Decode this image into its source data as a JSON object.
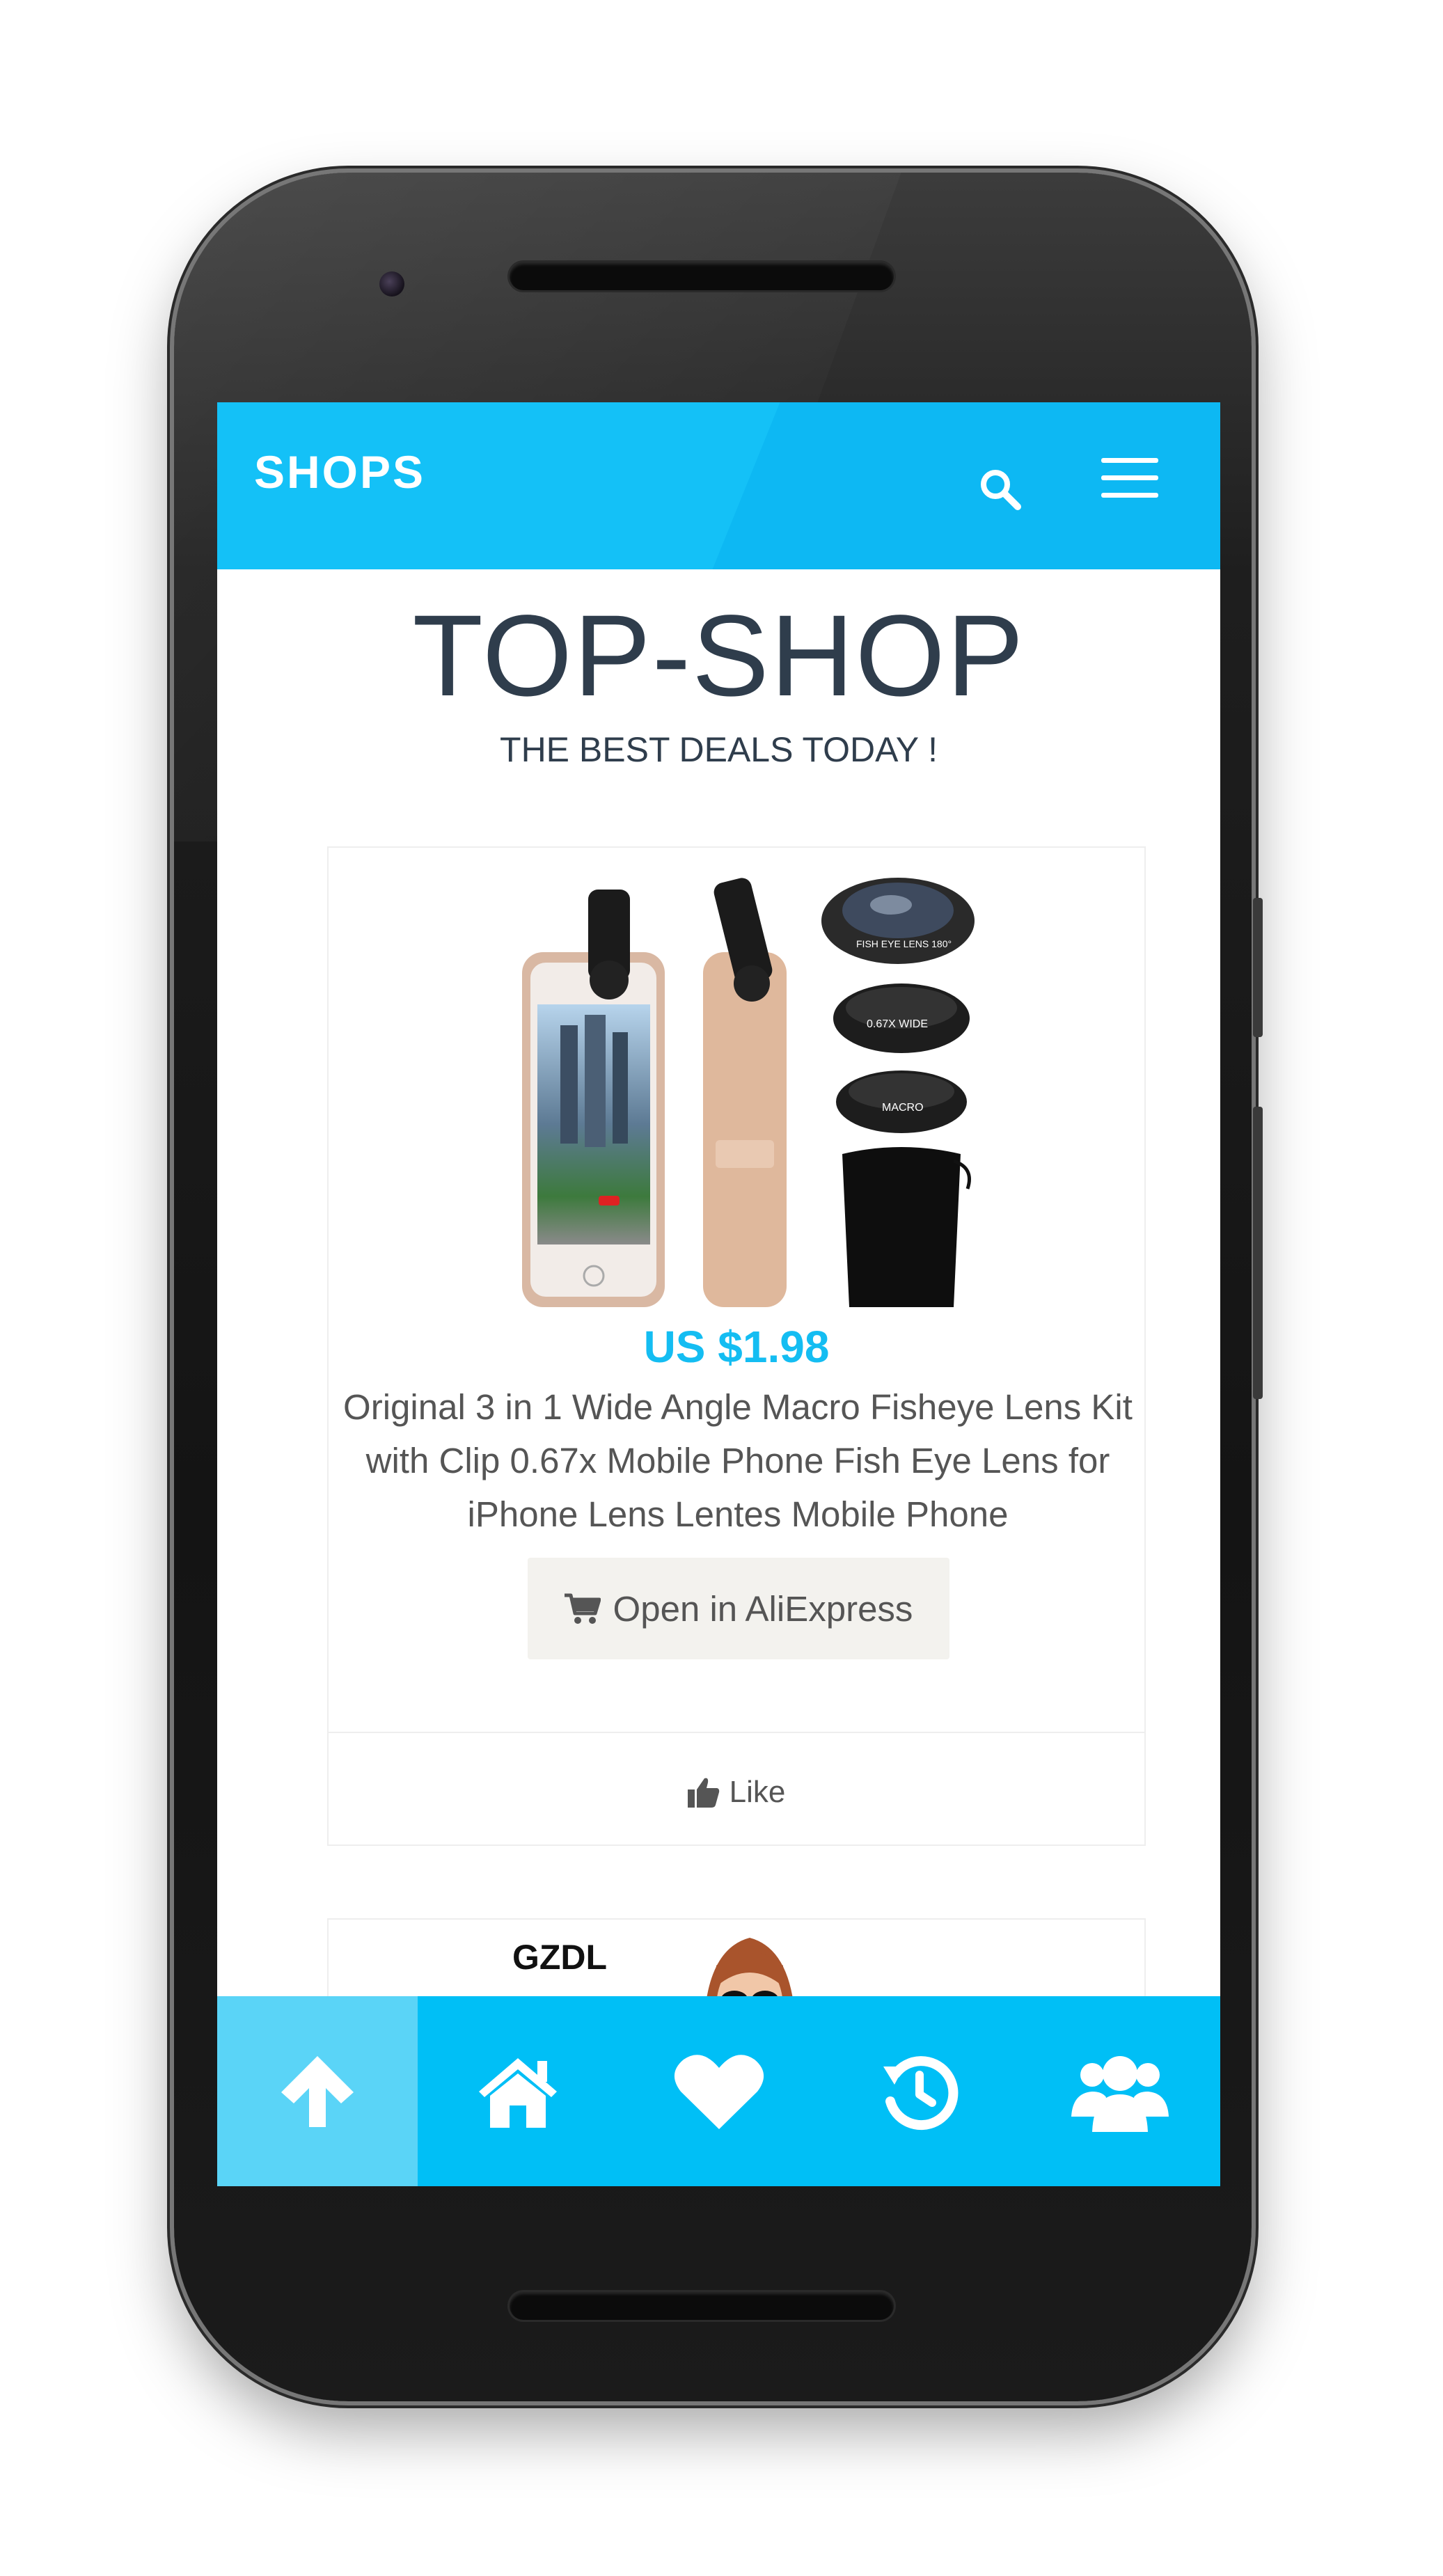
{
  "appbar": {
    "brand": "SHOPS",
    "search_icon": "search-icon",
    "menu_icon": "hamburger-menu-icon"
  },
  "page": {
    "title": "TOP-SHOP",
    "subtitle": "THE BEST DEALS TODAY !"
  },
  "product": {
    "price": "US $1.98",
    "description": "Original 3 in 1 Wide Angle Macro Fisheye Lens Kit with Clip 0.67x Mobile Phone Fish Eye Lens for iPhone Lens Lentes Mobile Phone",
    "image_labels": {
      "fisheye": "FISH EYE LENS 180°",
      "wide": "0.67X WIDE",
      "macro": "MACRO"
    },
    "open_button": "Open in AliExpress",
    "like_button": "Like"
  },
  "next_product": {
    "brand": "GZDL"
  },
  "bottom_nav": [
    {
      "icon": "arrow-up-icon",
      "active": true
    },
    {
      "icon": "home-icon",
      "active": false
    },
    {
      "icon": "heart-icon",
      "active": false
    },
    {
      "icon": "history-icon",
      "active": false
    },
    {
      "icon": "users-icon",
      "active": false
    }
  ],
  "colors": {
    "accent": "#14c1f7",
    "nav_active": "#5ad4f7",
    "title_text": "#2f3d4c",
    "price": "#14bdf2"
  }
}
